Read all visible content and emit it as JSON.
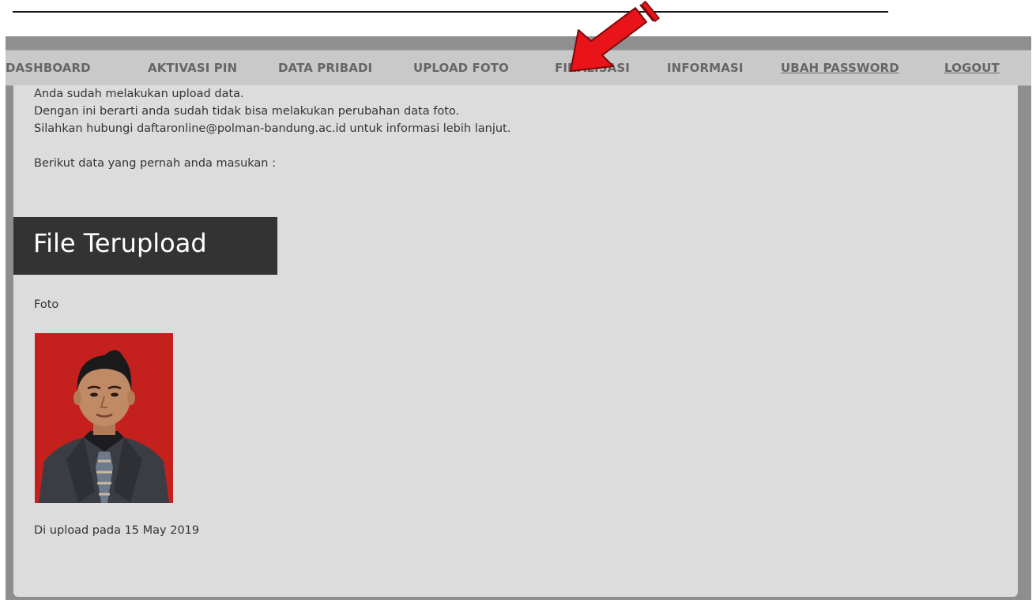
{
  "nav": {
    "items": [
      {
        "label": "DASHBOARD"
      },
      {
        "label": "AKTIVASI PIN"
      },
      {
        "label": "DATA PRIBADI"
      },
      {
        "label": "UPLOAD FOTO"
      },
      {
        "label": "FINALISASI"
      },
      {
        "label": "INFORMASI"
      },
      {
        "label": "UBAH PASSWORD"
      },
      {
        "label": "LOGOUT"
      }
    ]
  },
  "intro": {
    "line1": "Anda sudah melakukan upload data.",
    "line2": "Dengan ini berarti anda sudah tidak bisa melakukan perubahan data foto.",
    "line3": "Silahkan hubungi daftaronline@polman-bandung.ac.id untuk informasi lebih lanjut.",
    "line4": "Berikut data yang pernah anda masukan :"
  },
  "section": {
    "title": "File Terupload",
    "foto_label": "Foto",
    "upload_date": "Di upload pada 15 May 2019"
  },
  "colors": {
    "nav_background": "#c9c9c9",
    "nav_text": "#666666",
    "panel_background": "#dcdcdc",
    "header_background": "#333333",
    "photo_background": "#c3201e",
    "arrow": "#e8141a"
  },
  "icons": {
    "annotation": "red-arrow-icon"
  }
}
